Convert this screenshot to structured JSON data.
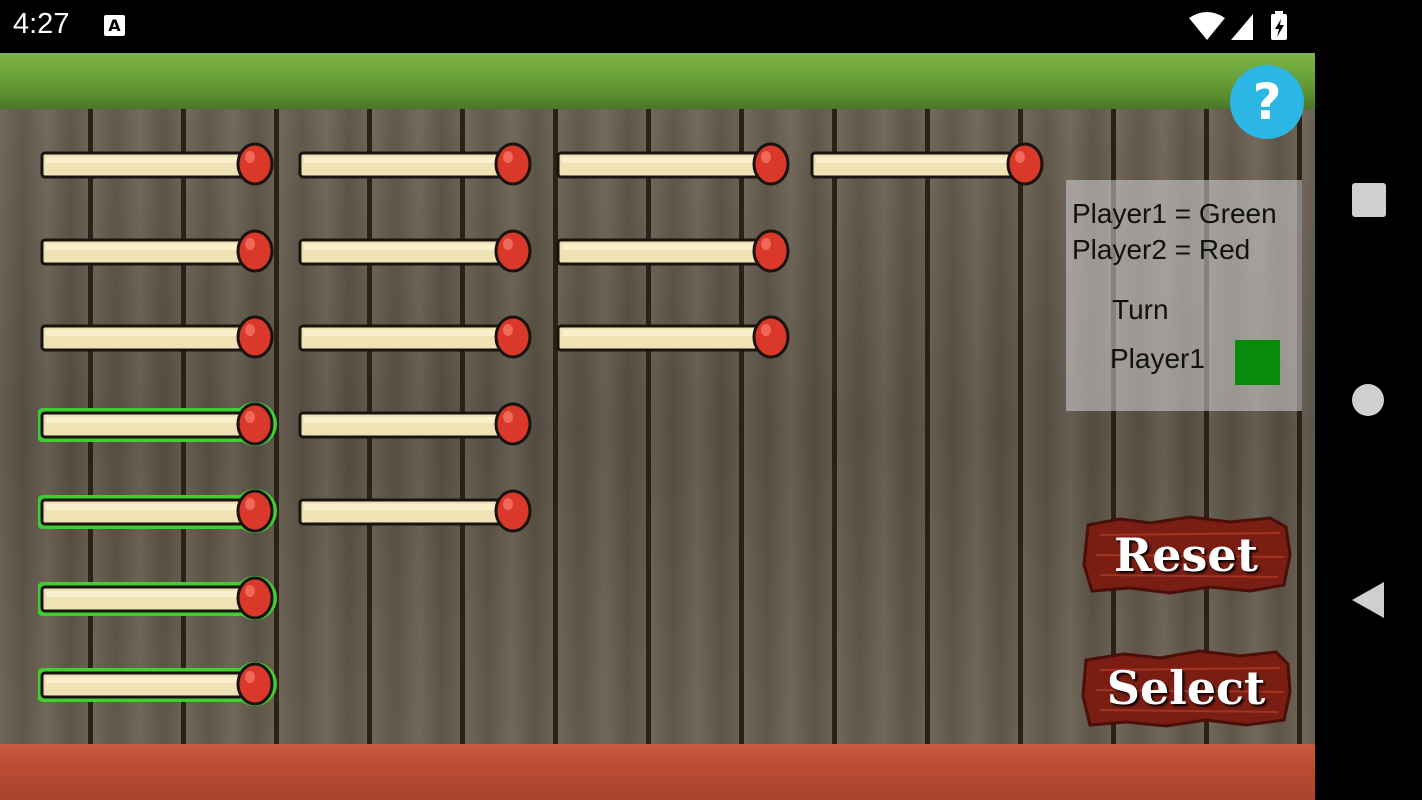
{
  "status_bar": {
    "time": "4:27",
    "notification_icon": "A"
  },
  "help": {
    "label": "?"
  },
  "info_panel": {
    "player1_line": "Player1 = Green",
    "player2_line": "Player2 = Red",
    "turn_label": "Turn",
    "current_player": "Player1",
    "current_player_color": "#0a8a0a"
  },
  "buttons": {
    "reset": "Reset",
    "select": "Select"
  },
  "board": {
    "columns": [
      {
        "count": 7,
        "selected": [
          false,
          false,
          false,
          true,
          true,
          true,
          true
        ]
      },
      {
        "count": 5,
        "selected": [
          false,
          false,
          false,
          false,
          false
        ]
      },
      {
        "count": 3,
        "selected": [
          false,
          false,
          false
        ]
      },
      {
        "count": 1,
        "selected": [
          false
        ]
      }
    ]
  },
  "colors": {
    "selection_outline": "#3fcf2f",
    "match_head": "#d9382a",
    "match_stick": "#efe2b4"
  }
}
